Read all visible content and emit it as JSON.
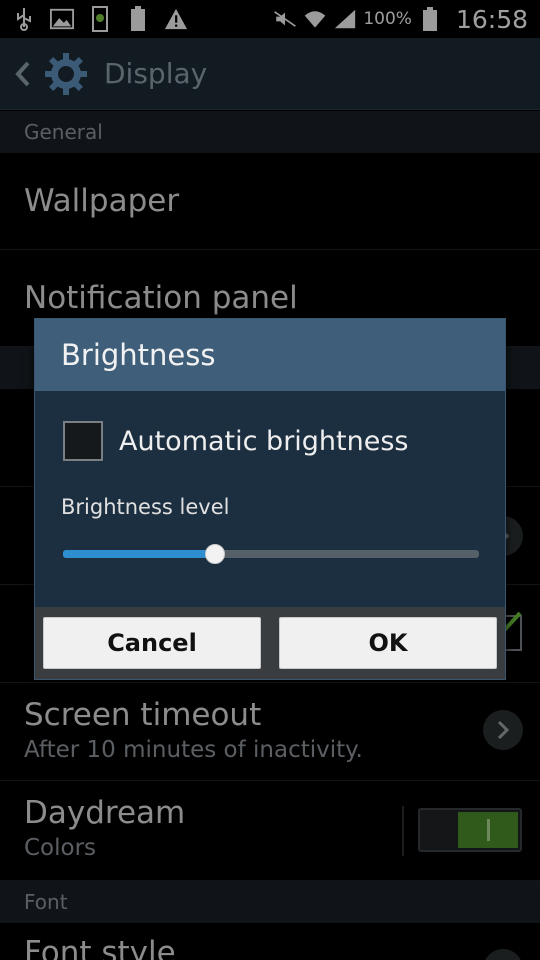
{
  "status_bar": {
    "battery_percent": "100%",
    "clock": "16:58",
    "icons": [
      "usb-icon",
      "image-icon",
      "android-debug-icon",
      "battery-full-small-icon",
      "warning-icon",
      "mute-icon",
      "wifi-icon",
      "signal-icon",
      "battery-icon"
    ]
  },
  "action_bar": {
    "title": "Display"
  },
  "list": {
    "general_header": "General",
    "wallpaper": "Wallpaper",
    "notification_panel": "Notification panel",
    "screen_timeout": {
      "title": "Screen timeout",
      "subtitle": "After 10 minutes of inactivity."
    },
    "daydream": {
      "title": "Daydream",
      "subtitle": "Colors",
      "enabled": true
    },
    "font_header": "Font",
    "font_style": "Font style"
  },
  "dialog": {
    "title": "Brightness",
    "auto_brightness_label": "Automatic brightness",
    "auto_brightness_checked": false,
    "level_label": "Brightness level",
    "level_fraction": 0.365,
    "cancel_label": "Cancel",
    "ok_label": "OK"
  },
  "colors": {
    "accent": "#2d8fd0",
    "dialog_title_bg": "#3f5e7a",
    "toggle_on": "#4a8a2c"
  }
}
